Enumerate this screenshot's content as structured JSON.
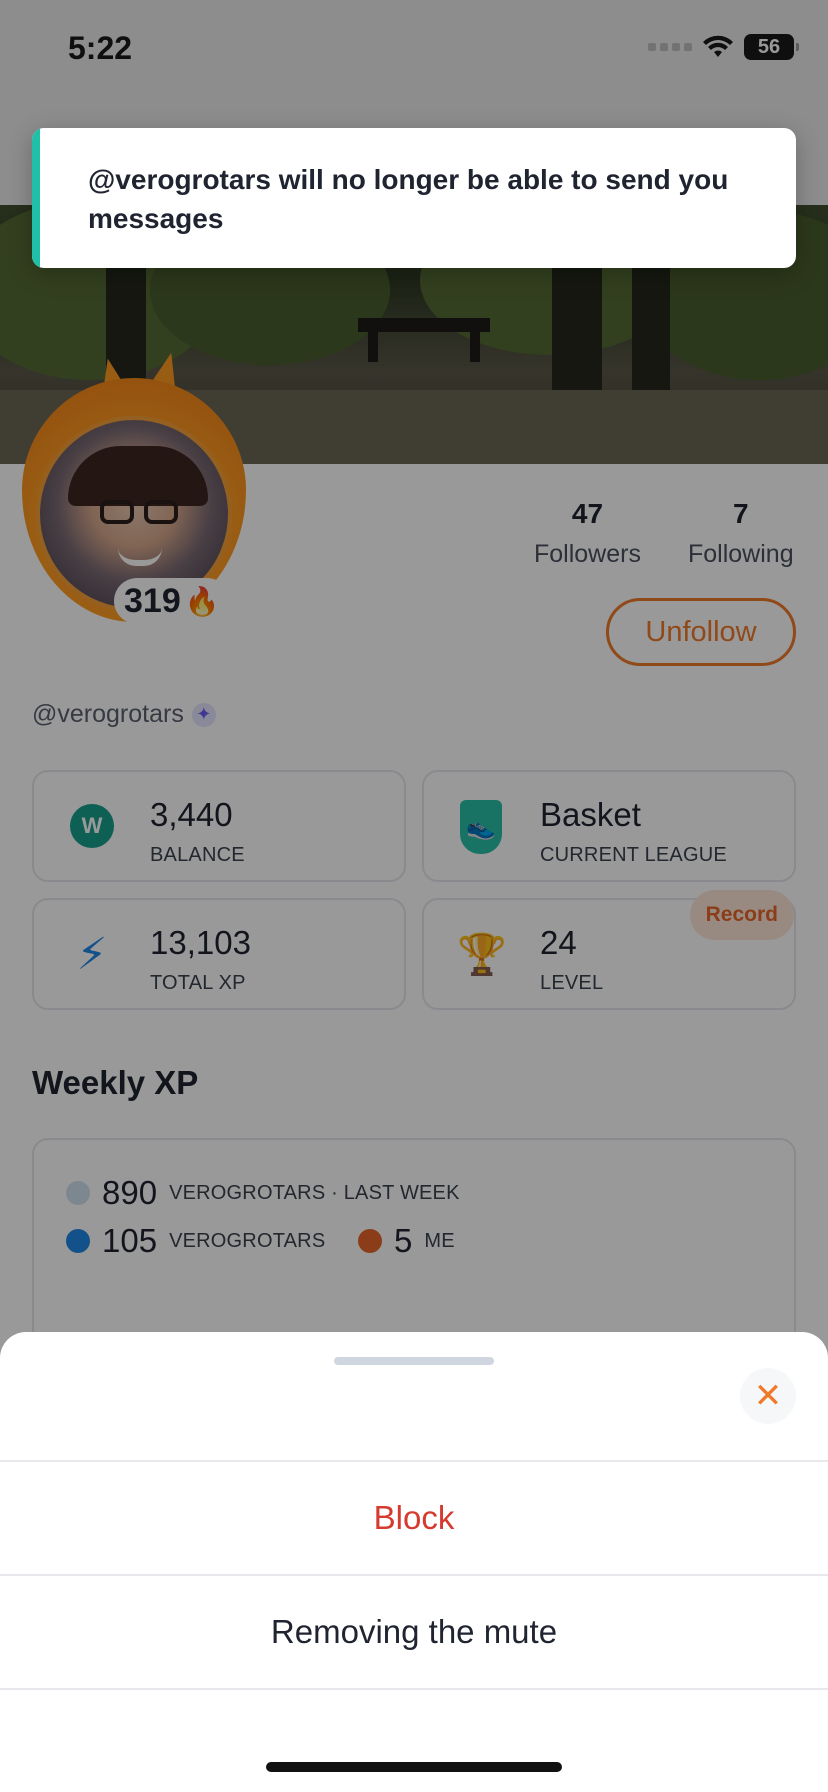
{
  "status_bar": {
    "time": "5:22",
    "battery": "56"
  },
  "toast": {
    "message": "@verogrotars will no longer be able to send you messages",
    "accent_color": "#1fbfa8"
  },
  "profile": {
    "streak_count": "319",
    "followers_count": "47",
    "followers_label": "Followers",
    "following_count": "7",
    "following_label": "Following",
    "unfollow_label": "Unfollow",
    "username": "@verogrotars"
  },
  "cards": {
    "balance_value": "3,440",
    "balance_label": "BALANCE",
    "league_value": "Basket",
    "league_label": "CURRENT LEAGUE",
    "xp_value": "13,103",
    "xp_label": "TOTAL XP",
    "level_value": "24",
    "level_label": "LEVEL",
    "record_badge": "Record",
    "coin_letter": "W"
  },
  "weekly_xp": {
    "title": "Weekly XP",
    "legend": [
      {
        "value": "890",
        "label": "VEROGROTARS · LAST WEEK",
        "color": "#cfe1ee"
      },
      {
        "value": "105",
        "label": "VEROGROTARS",
        "color": "#1e88e5"
      },
      {
        "value": "5",
        "label": "ME",
        "color": "#e8672a"
      }
    ]
  },
  "sheet": {
    "block_label": "Block",
    "unmute_label": "Removing the mute",
    "close_icon": "close-icon"
  },
  "colors": {
    "accent_orange": "#f07a2a",
    "danger_red": "#d63a2f",
    "overlay": "rgba(0,0,0,0.40)"
  }
}
